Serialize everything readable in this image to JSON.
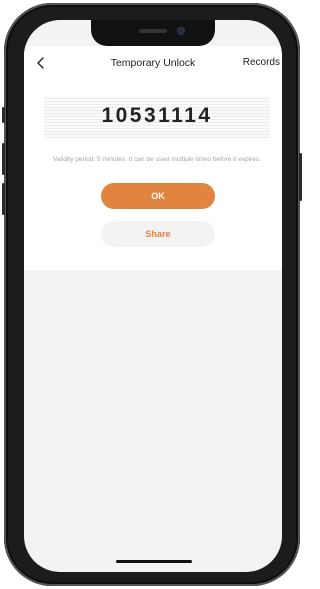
{
  "header": {
    "title": "Temporary Unlock",
    "records_label": "Records"
  },
  "unlock": {
    "code": "10531114",
    "validity_text": "Validity period: 5 minutes. It can be used multiple times before it expires."
  },
  "actions": {
    "ok_label": "OK",
    "share_label": "Share"
  },
  "colors": {
    "accent": "#e0843f",
    "text": "#222222",
    "hint": "#a6a6a6",
    "background": "#f3f3f3"
  },
  "icons": {
    "back": "chevron-left-icon"
  }
}
